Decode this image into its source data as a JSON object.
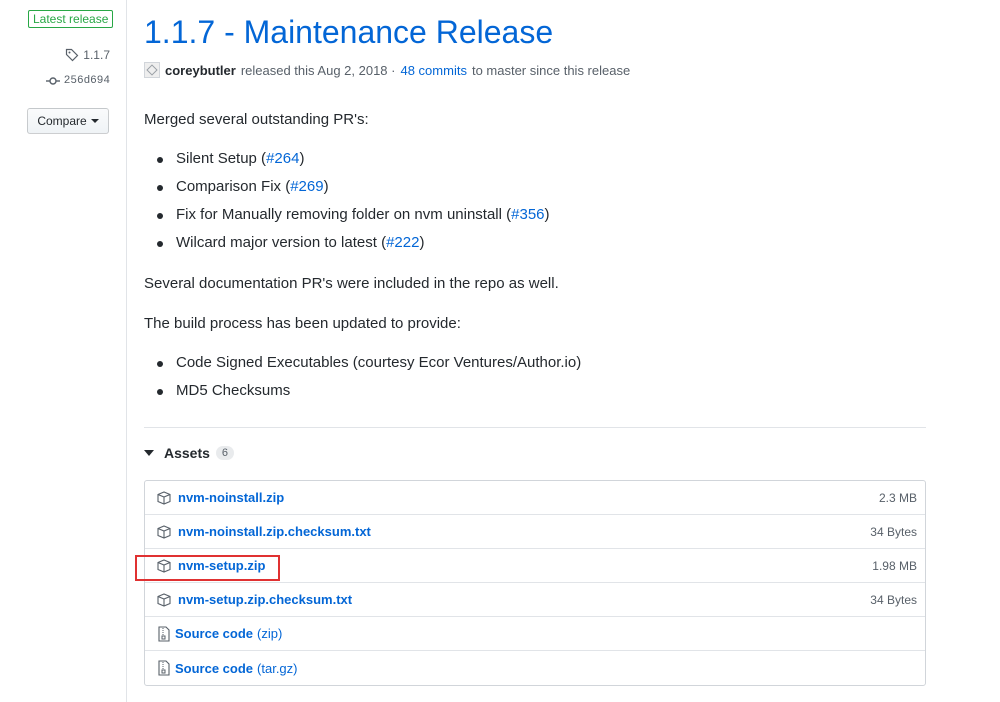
{
  "sidebar": {
    "latest_badge": "Latest release",
    "tag": "1.1.7",
    "commit": "256d694",
    "compare_label": "Compare",
    "badge_color": "#28a745"
  },
  "release": {
    "title": "1.1.7 - Maintenance Release",
    "author": "coreybutler",
    "released_text": "released this Aug 2, 2018 ·",
    "commits_link": "48 commits",
    "commits_suffix": "to master since this release"
  },
  "notes": {
    "intro": "Merged several outstanding PR's:",
    "pr_items": [
      {
        "text": "Silent Setup (",
        "link": "#264",
        "tail": ")"
      },
      {
        "text": "Comparison Fix (",
        "link": "#269",
        "tail": ")"
      },
      {
        "text": "Fix for Manually removing folder on nvm uninstall (",
        "link": "#356",
        "tail": ")"
      },
      {
        "text": "Wilcard major version to latest (",
        "link": "#222",
        "tail": ")"
      }
    ],
    "docs": "Several documentation PR's were included in the repo as well.",
    "build_intro": "The build process has been updated to provide:",
    "build_items": [
      "Code Signed Executables (courtesy Ecor Ventures/Author.io)",
      "MD5 Checksums"
    ]
  },
  "assets": {
    "heading": "Assets",
    "count": "6",
    "files": [
      {
        "name": "nvm-noinstall.zip",
        "size": "2.3 MB",
        "icon": "package-icon"
      },
      {
        "name": "nvm-noinstall.zip.checksum.txt",
        "size": "34 Bytes",
        "icon": "package-icon"
      },
      {
        "name": "nvm-setup.zip",
        "size": "1.98 MB",
        "icon": "package-icon"
      },
      {
        "name": "nvm-setup.zip.checksum.txt",
        "size": "34 Bytes",
        "icon": "package-icon"
      }
    ],
    "sources": [
      {
        "name": "Source code",
        "suffix": "(zip)",
        "icon": "file-zip-icon"
      },
      {
        "name": "Source code",
        "suffix": "(tar.gz)",
        "icon": "file-zip-icon"
      }
    ]
  },
  "colors": {
    "link": "#0366d6",
    "highlight": "#e03131"
  }
}
